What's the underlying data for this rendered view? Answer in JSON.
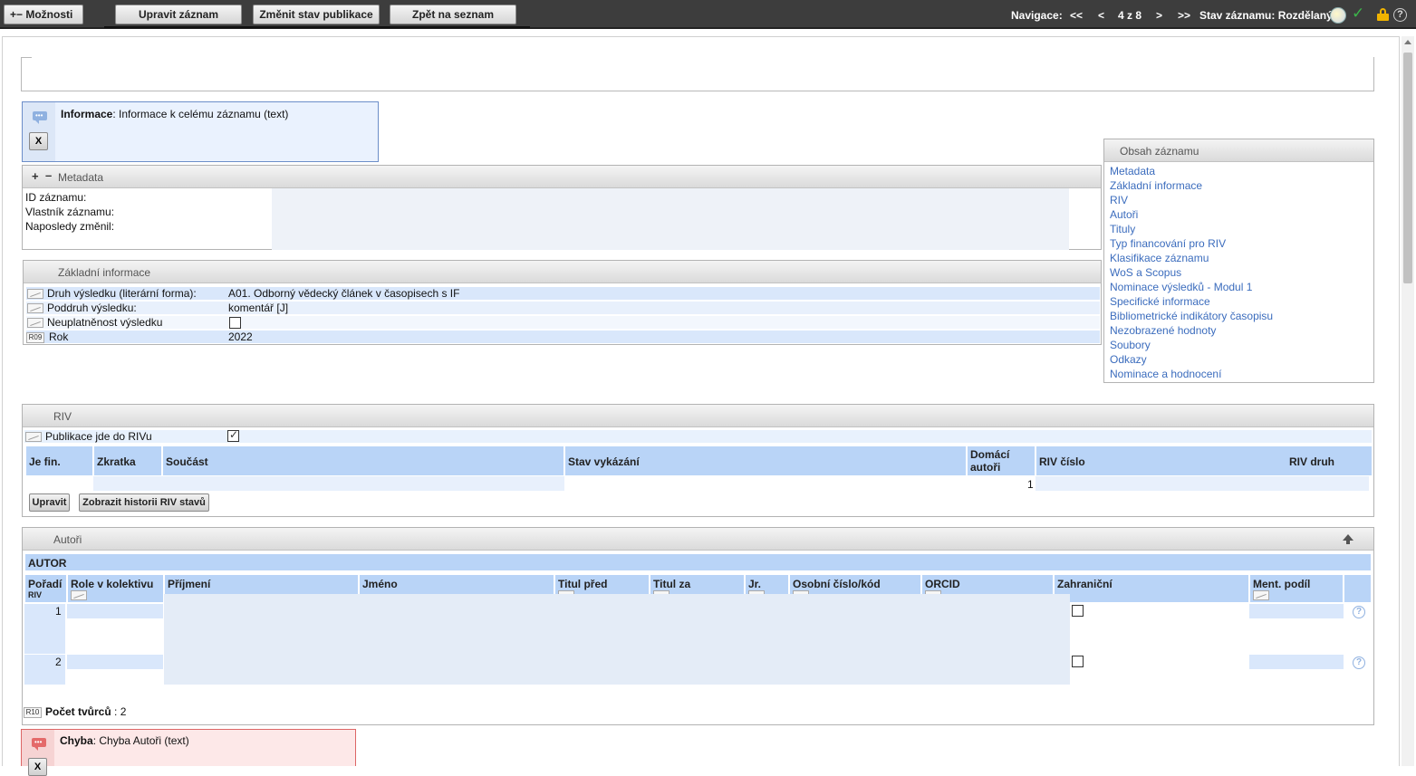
{
  "toolbar": {
    "options_label": "Možnosti",
    "edit_label": "Upravit záznam",
    "publication_state_label": "Změnit stav publikace",
    "back_label": "Zpět na seznam",
    "nav_label": "Navigace:",
    "nav_first": "<<",
    "nav_prev": "<",
    "nav_position": "4 z 8",
    "nav_next": ">",
    "nav_last": ">>",
    "record_state": "Stav záznamu: Rozdělaný"
  },
  "info_message": {
    "title": "Informace",
    "text": ": Informace k celému záznamu (text)",
    "close": "X"
  },
  "metadata": {
    "title": "Metadata",
    "labels": [
      "ID záznamu:",
      "Vlastník záznamu:",
      "Naposledy změnil:"
    ]
  },
  "basic_info": {
    "title": "Základní informace",
    "rows": [
      {
        "label": "Druh výsledku (literární forma):",
        "value": "A01. Odborný vědecký článek v časopisech s IF"
      },
      {
        "label": "Poddruh výsledku:",
        "value": "komentář [J]"
      },
      {
        "label": "Neuplatněnost výsledku",
        "value": ""
      },
      {
        "code": "R09",
        "label": "Rok",
        "value": "2022"
      }
    ]
  },
  "toc": {
    "title": "Obsah záznamu",
    "items": [
      "Metadata",
      "Základní informace",
      "RIV",
      "Autoři",
      "Tituly",
      "Typ financování pro RIV",
      "Klasifikace záznamu",
      "WoS a Scopus",
      "Nominace výsledků - Modul 1",
      "Specifické informace",
      "Bibliometrické indikátory časopisu",
      "Nezobrazené hodnoty",
      "Soubory",
      "Odkazy",
      "Nominace a hodnocení"
    ]
  },
  "riv": {
    "title": "RIV",
    "publication_label": "Publikace jde do RIVu",
    "columns": [
      "Je fin.",
      "Zkratka",
      "Součást",
      "Stav vykázání",
      "Domácí autoři",
      "RIV číslo",
      "RIV druh"
    ],
    "row_value": "1",
    "edit_button": "Upravit",
    "history_button": "Zobrazit historii RIV stavů"
  },
  "authors": {
    "title": "Autoři",
    "section": "AUTOR",
    "columns": [
      "Pořadí",
      "Role v kolektivu",
      "Příjmení",
      "Jméno",
      "Titul před",
      "Titul za",
      "Jr.",
      "Osobní číslo/kód",
      "ORCID",
      "Zahraniční",
      "Ment. podíl"
    ],
    "riv_tag": "RIV",
    "rows": [
      "1",
      "2"
    ],
    "count_code": "R10",
    "count_label": "Počet tvůrců",
    "count_value": ": 2"
  },
  "error_message": {
    "title": "Chyba",
    "text": ": Chyba Autoři (text)",
    "close": "X"
  },
  "colors": {
    "toolbar_bg": "#3d3d3d",
    "header_blue": "#b9d4f7",
    "row_blue": "#d9e7fb",
    "link": "#3b6cbd",
    "info_bg": "#eaf2fe",
    "error_bg": "#fde8e8"
  }
}
